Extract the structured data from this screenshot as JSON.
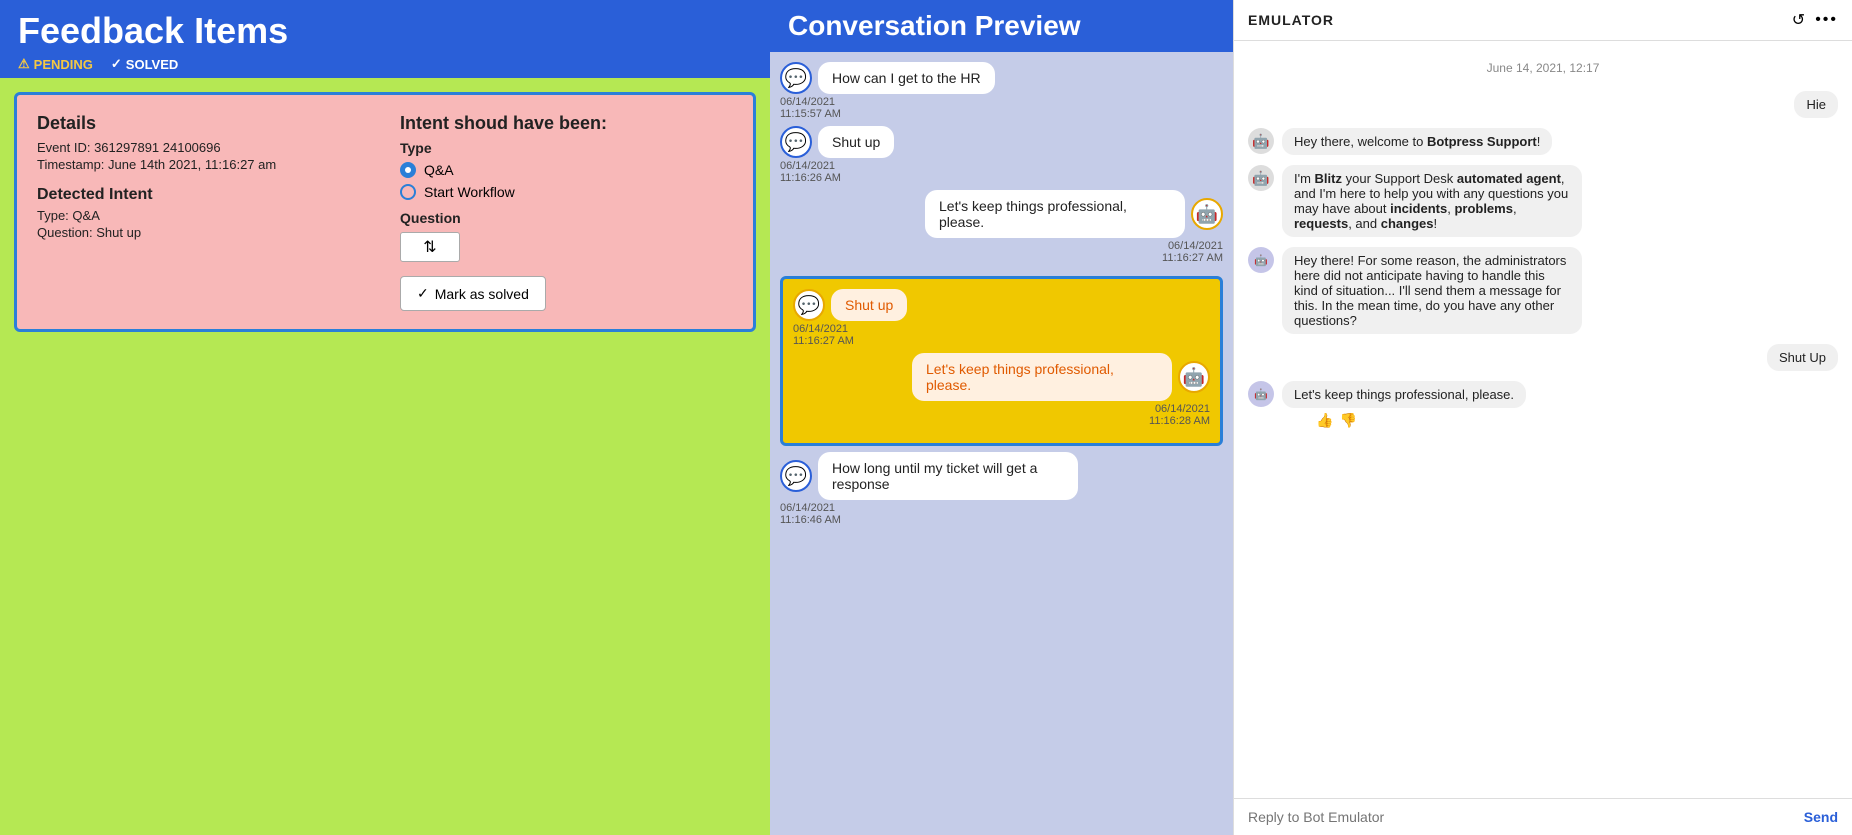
{
  "left": {
    "title": "Feedback Items",
    "tab_pending": "PENDING",
    "tab_solved": "SOLVED",
    "card": {
      "details_title": "Details",
      "event_id_label": "Event ID: 361297891 24100696",
      "timestamp_label": "Timestamp: June 14th 2021, 11:16:27 am",
      "detected_intent_title": "Detected Intent",
      "type_label": "Type: Q&A",
      "question_label": "Question: Shut up",
      "intent_title": "Intent shoud have been:",
      "type_field": "Type",
      "radio_qa": "Q&A",
      "radio_workflow": "Start Workflow",
      "question_field": "Question",
      "mark_solved": "Mark as solved"
    }
  },
  "middle": {
    "title": "Conversation Preview",
    "messages": [
      {
        "id": "msg1",
        "type": "user",
        "text": "How can I get to the HR",
        "timestamp": "06/14/2021\n11:15:57 AM"
      },
      {
        "id": "msg2",
        "type": "user",
        "text": "Shut up",
        "timestamp": "06/14/2021\n11:16:26 AM"
      },
      {
        "id": "msg3",
        "type": "bot",
        "text": "Let's keep things professional, please.",
        "timestamp": "06/14/2021\n11:16:27 AM"
      },
      {
        "id": "msg4_highlighted_user",
        "type": "user_highlighted",
        "text": "Shut up",
        "timestamp": "06/14/2021\n11:16:27 AM"
      },
      {
        "id": "msg5_highlighted_bot",
        "type": "bot_highlighted",
        "text": "Let's keep things professional, please.",
        "timestamp": "06/14/2021\n11:16:28 AM"
      },
      {
        "id": "msg6",
        "type": "user",
        "text": "How long until my ticket will get a response",
        "timestamp": "06/14/2021\n11:16:46 AM"
      }
    ]
  },
  "right": {
    "title": "EMULATOR",
    "date": "June 14, 2021, 12:17",
    "messages": [
      {
        "id": "r1",
        "type": "user",
        "text": "Hie"
      },
      {
        "id": "r2",
        "type": "bot",
        "html": true,
        "text": "Hey there, welcome to Botpress Support!"
      },
      {
        "id": "r3",
        "type": "bot",
        "text": "I'm Blitz your Support Desk automated agent, and I'm here to help you with any questions you may have about incidents, problems, requests, and changes!"
      },
      {
        "id": "r4",
        "type": "bot",
        "text": "Hey there! For some reason, the administrators here did not anticipate having to handle this kind of situation... I'll send them a message for this. In the mean time, do you have any other questions?"
      },
      {
        "id": "r5",
        "type": "user",
        "text": "Shut Up"
      },
      {
        "id": "r6",
        "type": "bot",
        "text": "Let's keep things professional, please.",
        "has_thumbs": true
      }
    ],
    "input_placeholder": "Reply to Bot Emulator",
    "send_label": "Send"
  }
}
